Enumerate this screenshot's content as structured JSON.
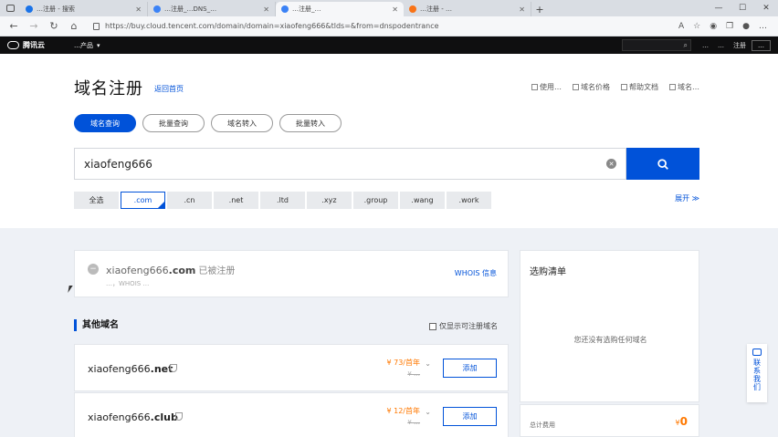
{
  "browser": {
    "tabs": [
      {
        "label": "…注册 - 搜索",
        "active": false,
        "color": "#1a73e8"
      },
      {
        "label": "…注册_…DNS_…",
        "active": false,
        "color": "#3b82f6"
      },
      {
        "label": "…注册_…",
        "active": true,
        "color": "#3b82f6"
      },
      {
        "label": "…注册 - …",
        "active": false,
        "color": "#f97316"
      }
    ],
    "new_tab": "+",
    "url": "https://buy.cloud.tencent.com/domain/domain=xiaofeng666&tlds=&from=dnspodentrance"
  },
  "site_header": {
    "logo": "腾讯云",
    "products": "…产品",
    "search_icon": "⌕",
    "links": [
      "…",
      "…",
      "注册"
    ],
    "console": "…"
  },
  "top": {
    "title": "域名注册",
    "back_link": "返回首页",
    "links": [
      "使用…",
      "域名价格",
      "帮助文档",
      "域名…"
    ],
    "mode_tabs": [
      "域名查询",
      "批量查询",
      "域名转入",
      "批量转入"
    ]
  },
  "search": {
    "value": "xiaofeng666",
    "clear_icon": "✕"
  },
  "suffixes": {
    "items": [
      "全选",
      ".com",
      ".cn",
      ".net",
      ".ltd",
      ".xyz",
      ".group",
      ".wang",
      ".work"
    ],
    "selected": ".com",
    "expand": "展开 ≫"
  },
  "registered": {
    "icon": "−",
    "domain_name": "xiaofeng666",
    "domain_tld": ".com",
    "status": "已被注册",
    "sub": "…，WHOIS …",
    "whois_link": "WHOIS 信息"
  },
  "other_domains": {
    "title": "其他域名",
    "only_available": "仅显示可注册域名",
    "rows": [
      {
        "name": "xiaofeng666",
        "tld": ".net",
        "price": "¥ 73/首年",
        "old_price": "¥ …",
        "add": "添加"
      },
      {
        "name": "xiaofeng666",
        "tld": ".club",
        "price": "¥ 12/首年",
        "old_price": "¥ …",
        "add": "添加"
      }
    ]
  },
  "cart": {
    "title": "选购清单",
    "empty_text": "您还没有选购任何域名",
    "total_label": "总计费用",
    "currency": "¥",
    "total_value": "0"
  },
  "contact": {
    "text": "联系我们"
  }
}
